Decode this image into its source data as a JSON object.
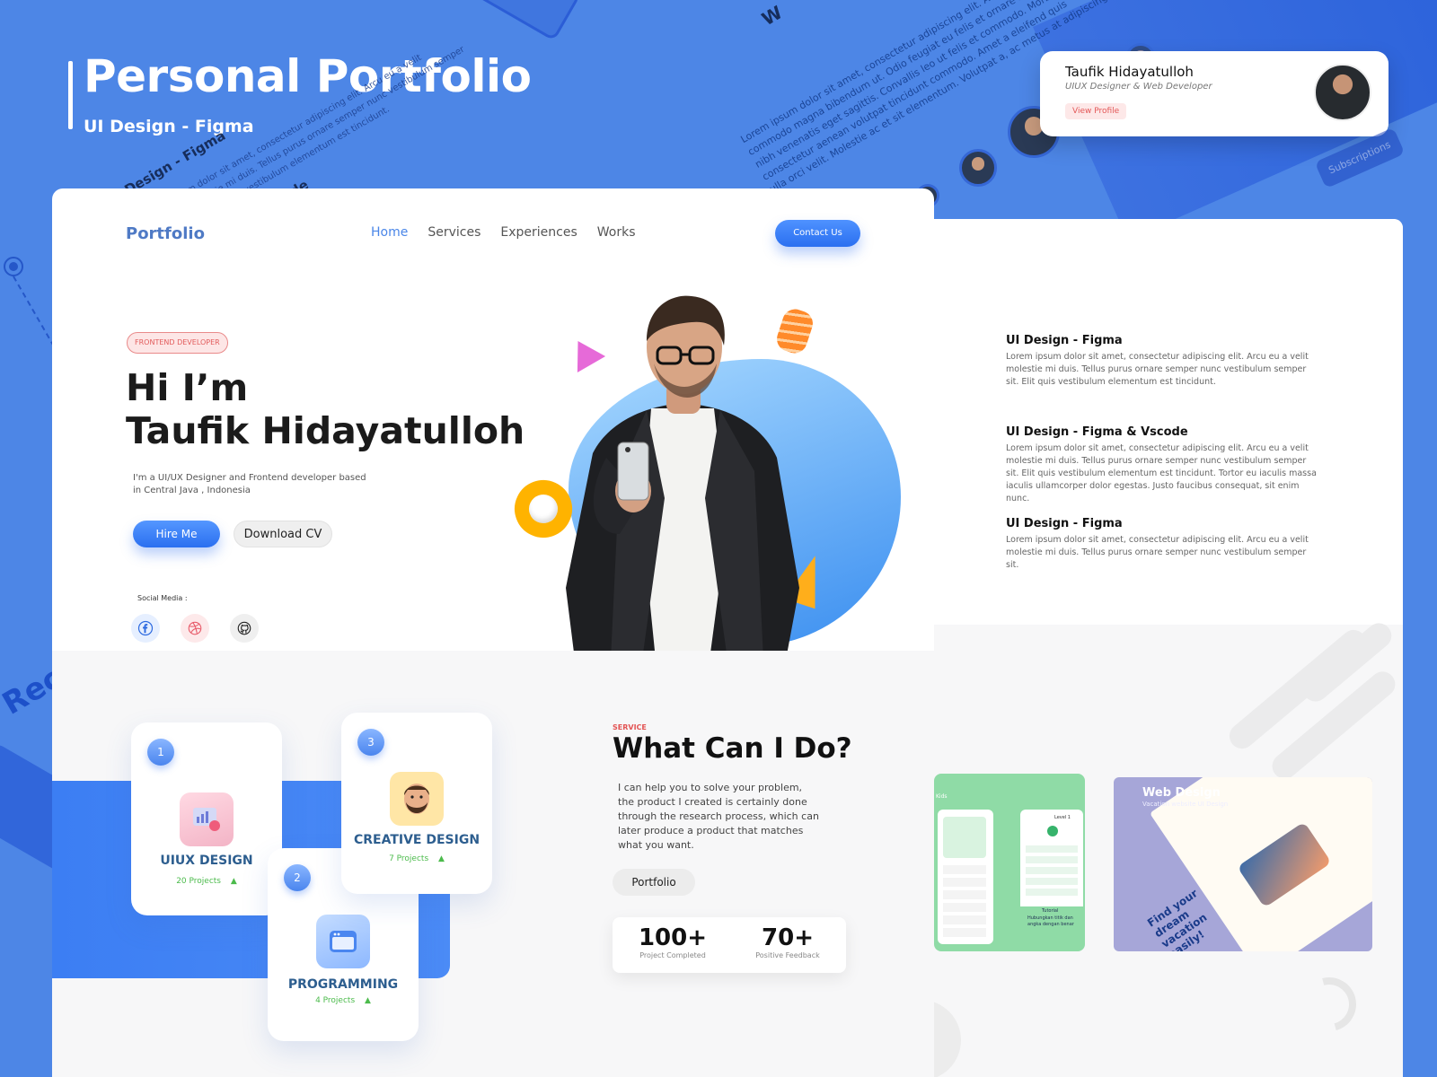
{
  "header": {
    "title": "Personal Portfolio",
    "subtitle": "UI Design - Figma"
  },
  "decor": {
    "lorem_lines": [
      "Lorem ipsum dolor sit amet, consectetur adipiscing elit. Arcu eu a velit",
      "commodo magna bibendum ut. Odio feugiat eu felis et ornare semper",
      "nibh venenatis eget sagittis. Convallis leo ut felis et commodo. Morbi so",
      "consectetur aenean volutpat tincidunt commodo. Amet a eleifend quis",
      "ulla orci velit. Molestie ac et sit elementum. Volutpat a, ac metus at adipiscing elit"
    ],
    "left_lines": [
      "um dolor sit amet, consectetur adipiscing elit. Arcu eu a velit",
      "molestie mi duis. Tellus purus ornare semper nunc vestibulum semper",
      "sit. Elit quis vestibulum elementum est tincidunt."
    ],
    "left_design_text": "Design - Figma",
    "left_code_text": "de",
    "left_rec": "Rece",
    "top_word": "W",
    "subscribe": "Subscriptions"
  },
  "profile_card": {
    "name": "Taufik Hidayatulloh",
    "role": "UIUX Designer & Web Developer",
    "button": "View Profile"
  },
  "nav": {
    "logo": "Portfolio",
    "links": [
      "Home",
      "Services",
      "Experiences",
      "Works"
    ],
    "active": "Home",
    "contact": "Contact Us"
  },
  "hero": {
    "tag": "FRONTEND DEVELOPER",
    "greeting": "Hi I’m",
    "name": "Taufik Hidayatulloh",
    "intro": "I'm a UI/UX Designer and Frontend developer  based in Central Java , Indonesia",
    "hire": "Hire Me",
    "download": "Download CV",
    "social_label": "Social Media :",
    "social_icons": [
      "facebook-icon",
      "dribbble-icon",
      "github-icon"
    ]
  },
  "services": {
    "tag": "SERVICE",
    "heading": "What Can I Do?",
    "body": "I can help you to solve your problem, the product I created is certainly done through the research process, which can later produce a product that matches what you want.",
    "portfolio": "Portfolio",
    "cards": [
      {
        "num": "1",
        "title": "UIUX DESIGN",
        "count": "20 Projects"
      },
      {
        "num": "2",
        "title": "PROGRAMMING",
        "count": "4 Projects"
      },
      {
        "num": "3",
        "title": "CREATIVE DESIGN",
        "count": "7 Projects"
      }
    ],
    "stats": [
      {
        "value": "100+",
        "label": "Project Completed"
      },
      {
        "value": "70+",
        "label": "Positive Feedback"
      }
    ]
  },
  "experiences": [
    {
      "title": "UI Design - Figma",
      "body": "Lorem ipsum dolor sit amet, consectetur adipiscing elit. Arcu eu a velit molestie mi duis. Tellus purus ornare semper nunc vestibulum semper sit. Elit quis vestibulum elementum est tincidunt."
    },
    {
      "title": "UI Design - Figma  & Vscode",
      "body": "Lorem ipsum dolor sit amet, consectetur adipiscing elit. Arcu eu a velit molestie mi duis. Tellus purus ornare semper nunc vestibulum semper sit. Elit quis vestibulum elementum est tincidunt. Tortor eu iaculis massa iaculis ullamcorper dolor egestas. Justo faucibus consequat, sit enim nunc."
    },
    {
      "title": "UI Design - Figma",
      "body": "Lorem ipsum dolor sit amet, consectetur adipiscing elit. Arcu eu a velit molestie mi duis. Tellus purus ornare semper nunc vestibulum semper sit."
    }
  ],
  "works": {
    "web_title": "Web Design",
    "web_sub": "Vacation website UI Design",
    "web_tagline": "Find your dream vacation easily!",
    "green_label": "Kids",
    "green_level": "Level 1",
    "green_tutorial": "Tutorial",
    "green_caption": "Hubungkan titik dan angka dengan benar"
  },
  "colors": {
    "brand_blue": "#4d86e6",
    "accent_blue": "#2a6ff0",
    "tag_red": "#e35454",
    "success_green": "#4cbb4c"
  }
}
